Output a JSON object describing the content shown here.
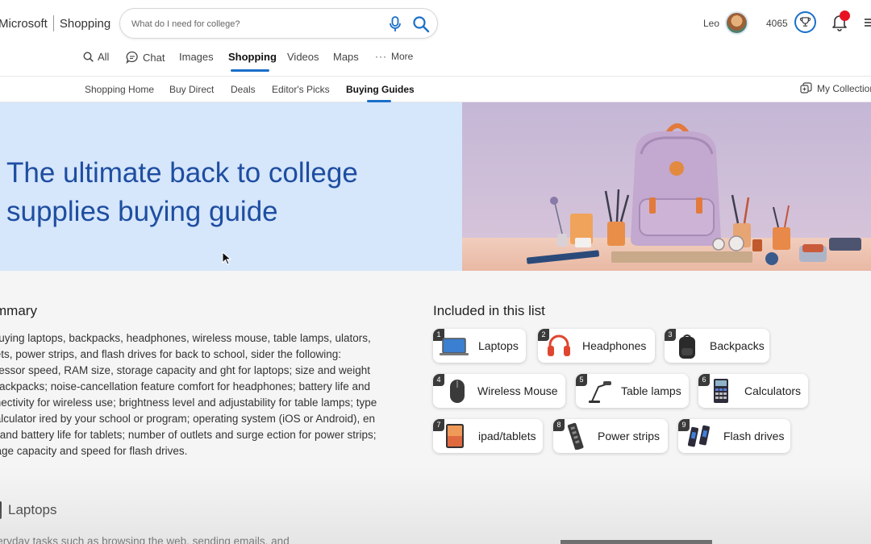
{
  "header": {
    "brand_main": "Microsoft",
    "brand_sub": "Shopping",
    "search_placeholder": "What do I need for college?",
    "user_name": "Leo",
    "points": "4065"
  },
  "scopes": [
    {
      "label": "All",
      "icon": "search-icon"
    },
    {
      "label": "Chat",
      "icon": "chat-icon"
    },
    {
      "label": "Images"
    },
    {
      "label": "Shopping",
      "active": true
    },
    {
      "label": "Videos"
    },
    {
      "label": "Maps"
    },
    {
      "label": "More",
      "icon": "more-icon"
    }
  ],
  "subnav": [
    {
      "label": "Shopping Home"
    },
    {
      "label": "Buy Direct"
    },
    {
      "label": "Deals"
    },
    {
      "label": "Editor's Picks"
    },
    {
      "label": "Buying Guides",
      "active": true
    }
  ],
  "collections_label": "My Collection",
  "hero": {
    "title": "The ultimate back to college supplies buying guide"
  },
  "summary": {
    "title": "mmary",
    "text": "en buying laptops, backpacks, headphones, wireless mouse, table lamps, ulators, tablets, power strips, and flash drives for back to school, sider the following: processor speed, RAM size, storage capacity and ght for laptops; size and weight for backpacks; noise-cancellation feature comfort for headphones; battery life and connectivity for wireless use; brightness level and adjustability for table lamps; type of calculator ired by your school or program; operating system (iOS or Android), en size and battery life for tablets; number of outlets and surge ection for power strips; storage capacity and speed for flash drives."
  },
  "included": {
    "title": "Included in this list",
    "items": [
      {
        "num": "1",
        "label": "Laptops",
        "icon": "laptop-icon"
      },
      {
        "num": "2",
        "label": "Headphones",
        "icon": "headphones-icon"
      },
      {
        "num": "3",
        "label": "Backpacks",
        "icon": "backpack-icon"
      },
      {
        "num": "4",
        "label": "Wireless Mouse",
        "icon": "mouse-icon"
      },
      {
        "num": "5",
        "label": "Table lamps",
        "icon": "lamp-icon"
      },
      {
        "num": "6",
        "label": "Calculators",
        "icon": "calculator-icon"
      },
      {
        "num": "7",
        "label": "ipad/tablets",
        "icon": "tablet-icon"
      },
      {
        "num": "8",
        "label": "Power strips",
        "icon": "power-strip-icon"
      },
      {
        "num": "9",
        "label": "Flash drives",
        "icon": "flash-drive-icon"
      }
    ]
  },
  "laptops_section": {
    "title": "Laptops",
    "text": "everyday tasks such as browsing the web, sending emails, and"
  },
  "colors": {
    "accent": "#1a6fc9",
    "hero_bg": "#d6e6fb",
    "hero_title": "#1e4ea1",
    "notification": "#e81123"
  }
}
